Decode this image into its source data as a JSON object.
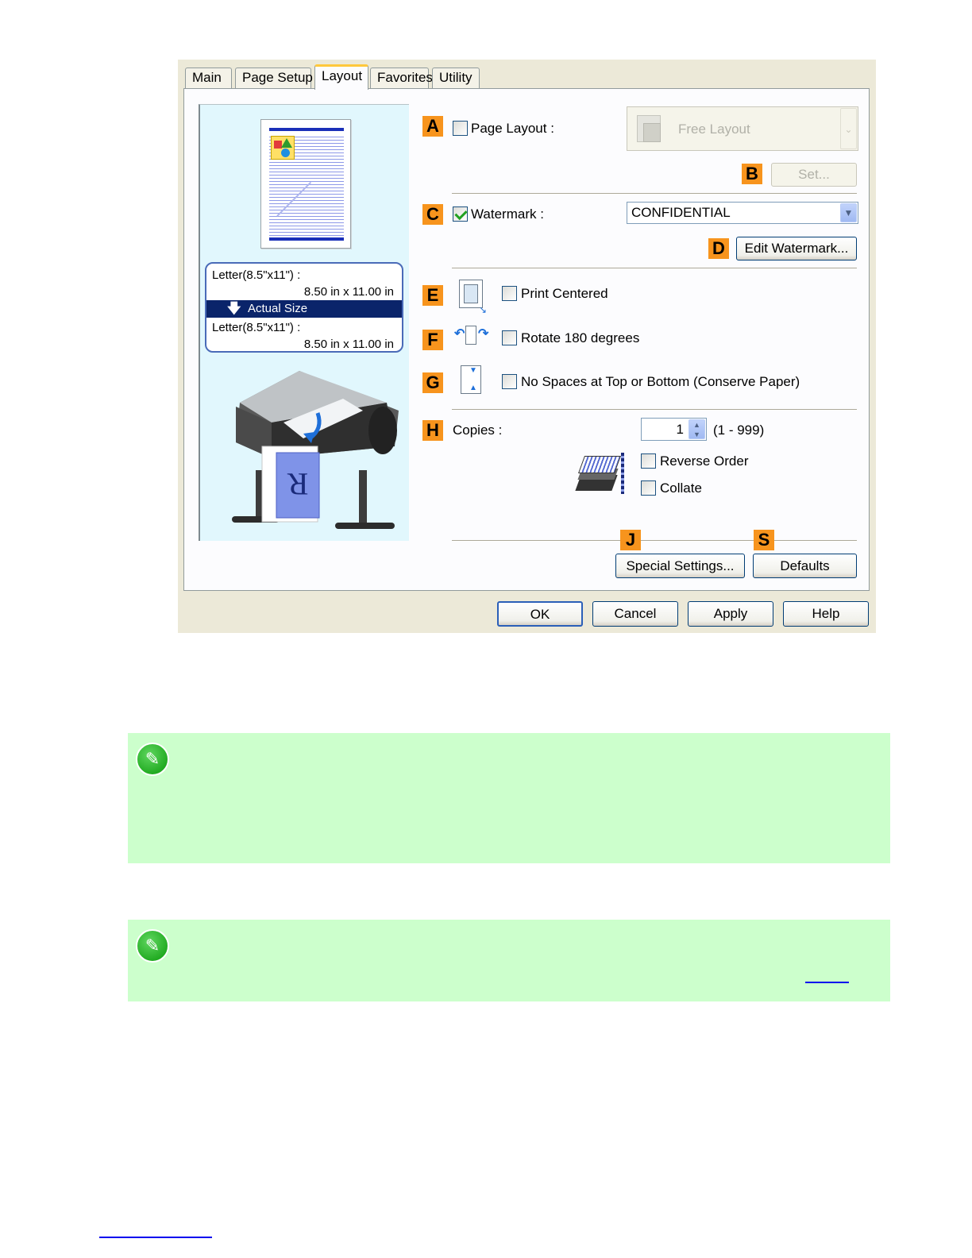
{
  "tabs": [
    "Main",
    "Page Setup",
    "Layout",
    "Favorites",
    "Utility"
  ],
  "active_tab": "Layout",
  "preview": {
    "input_size": "Letter(8.5\"x11\") :",
    "input_dims": "8.50 in x 11.00 in",
    "scaling": "Actual Size",
    "output_size": "Letter(8.5\"x11\") :",
    "output_dims": "8.50 in x 11.00 in",
    "sheet_letter": "R"
  },
  "badges": {
    "A": "A",
    "B": "B",
    "C": "C",
    "D": "D",
    "E": "E",
    "F": "F",
    "G": "G",
    "H": "H",
    "J": "J",
    "S": "S"
  },
  "page_layout": {
    "label": "Page Layout :",
    "checked": false,
    "combo_value": "Free Layout",
    "set_button": "Set..."
  },
  "watermark": {
    "label": "Watermark :",
    "checked": true,
    "value": "CONFIDENTIAL",
    "edit_button": "Edit Watermark..."
  },
  "options": {
    "print_centered": {
      "label": "Print Centered",
      "checked": false
    },
    "rotate_180": {
      "label": "Rotate 180 degrees",
      "checked": false
    },
    "no_spaces": {
      "label": "No Spaces at Top or Bottom (Conserve Paper)",
      "checked": false
    }
  },
  "copies": {
    "label": "Copies :",
    "value": "1",
    "range": "(1 - 999)",
    "reverse_order": "Reverse Order",
    "collate": "Collate"
  },
  "buttons": {
    "special_settings": "Special Settings...",
    "defaults": "Defaults",
    "ok": "OK",
    "cancel": "Cancel",
    "apply": "Apply",
    "help": "Help"
  },
  "icons": {
    "note": "pencil-note-icon"
  },
  "colors": {
    "badge": "#f7941d",
    "note_bg": "#ccffcc",
    "tab_highlight": "#ffc83c",
    "selected_row": "#0a246a"
  }
}
